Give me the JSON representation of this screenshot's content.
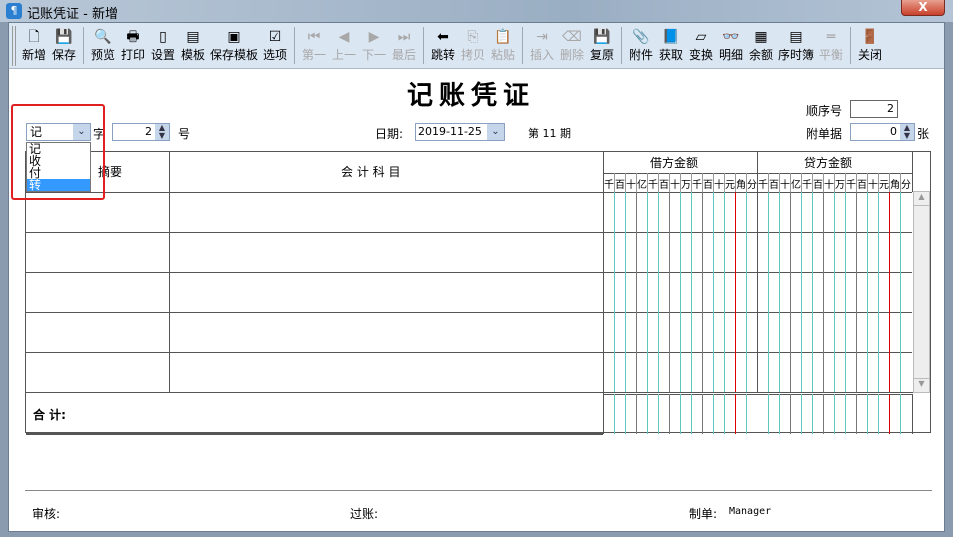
{
  "window": {
    "title": "记账凭证 - 新增",
    "close": "X"
  },
  "toolbar": [
    {
      "label": "新增",
      "icon": "🗋",
      "name": "new",
      "enabled": true
    },
    {
      "label": "保存",
      "icon": "💾",
      "name": "save",
      "enabled": true
    },
    {
      "sep": true
    },
    {
      "label": "预览",
      "icon": "🔍",
      "name": "preview",
      "enabled": true
    },
    {
      "label": "打印",
      "icon": "🖶",
      "name": "print",
      "enabled": true
    },
    {
      "label": "设置",
      "icon": "▯",
      "name": "settings",
      "enabled": true
    },
    {
      "label": "模板",
      "icon": "▤",
      "name": "template",
      "enabled": true
    },
    {
      "label": "保存模板",
      "icon": "▣",
      "name": "save-template",
      "enabled": true
    },
    {
      "label": "选项",
      "icon": "☑",
      "name": "options",
      "enabled": true
    },
    {
      "sep": true
    },
    {
      "label": "第一",
      "icon": "⏮",
      "name": "first",
      "enabled": false
    },
    {
      "label": "上一",
      "icon": "◀",
      "name": "previous",
      "enabled": false
    },
    {
      "label": "下一",
      "icon": "▶",
      "name": "next",
      "enabled": false
    },
    {
      "label": "最后",
      "icon": "⏭",
      "name": "last",
      "enabled": false
    },
    {
      "sep": true
    },
    {
      "label": "跳转",
      "icon": "⬅",
      "name": "jump",
      "enabled": true
    },
    {
      "label": "拷贝",
      "icon": "⎘",
      "name": "copy",
      "enabled": false
    },
    {
      "label": "粘贴",
      "icon": "📋",
      "name": "paste",
      "enabled": false
    },
    {
      "sep": true
    },
    {
      "label": "插入",
      "icon": "⇥",
      "name": "insert",
      "enabled": false
    },
    {
      "label": "删除",
      "icon": "⌫",
      "name": "delete",
      "enabled": false
    },
    {
      "label": "复原",
      "icon": "💾",
      "name": "restore",
      "enabled": true
    },
    {
      "sep": true
    },
    {
      "label": "附件",
      "icon": "📎",
      "name": "attachment",
      "enabled": true
    },
    {
      "label": "获取",
      "icon": "📘",
      "name": "fetch",
      "enabled": true
    },
    {
      "label": "变换",
      "icon": "▱",
      "name": "transform",
      "enabled": true
    },
    {
      "label": "明细",
      "icon": "👓",
      "name": "detail",
      "enabled": true
    },
    {
      "label": "余额",
      "icon": "▦",
      "name": "balance",
      "enabled": true
    },
    {
      "label": "序时簿",
      "icon": "▤",
      "name": "journal",
      "enabled": true
    },
    {
      "label": "平衡",
      "icon": "═",
      "name": "balance-check",
      "enabled": false
    },
    {
      "sep": true
    },
    {
      "label": "关闭",
      "icon": "🚪",
      "name": "close",
      "enabled": true
    }
  ],
  "voucher": {
    "title": "记账凭证",
    "type_value": "记",
    "type_options": [
      "记",
      "收",
      "付",
      "转"
    ],
    "type_selected": "转",
    "zi_label": "字",
    "number": "2",
    "hao_label": "号",
    "date_label": "日期:",
    "date": "2019-11-25",
    "period": "第 11 期",
    "seq_label": "顺序号",
    "seq": "2",
    "attach_label": "附单据",
    "attach": "0",
    "attach_unit": "张"
  },
  "table": {
    "col_summary": "摘要",
    "col_account": "会 计 科 目",
    "col_debit": "借方金额",
    "col_credit": "贷方金额",
    "digits": [
      "千",
      "百",
      "十",
      "亿",
      "千",
      "百",
      "十",
      "万",
      "千",
      "百",
      "十",
      "元",
      "角",
      "分"
    ],
    "total_label": "合  计:"
  },
  "footer": {
    "audit_label": "审核:",
    "post_label": "过账:",
    "maker_label": "制单:",
    "maker": "Manager"
  },
  "colors": {
    "highlight": "#e02020",
    "selection": "#3399ff",
    "digit_line": "#5cc8c0",
    "yuan_line": "#e00000"
  }
}
